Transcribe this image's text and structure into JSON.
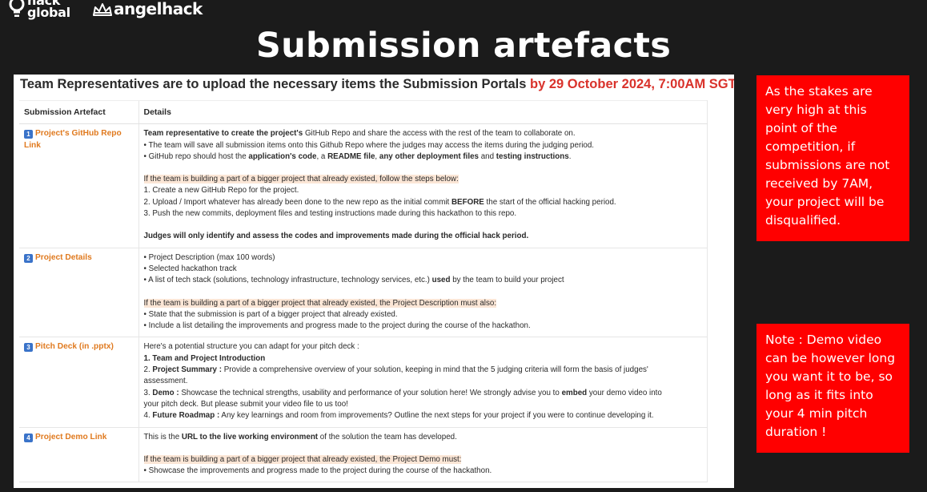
{
  "logos": {
    "hackglobal_line1": "hack",
    "hackglobal_line2": "global",
    "angelhack": "angelhack"
  },
  "slide_title": "Submission artefacts",
  "doc": {
    "heading": "Team Representatives are to upload the necessary items the Submission Portals",
    "deadline": "by 29 October 2024, 7:00AM SGT",
    "columns": [
      "Submission Artefact",
      "Details"
    ],
    "rows": [
      {
        "num": "1",
        "name_l1": "Project's GitHub Repo",
        "name_l2": "Link",
        "l1a": "Team representative to create the project's ",
        "l1b": "GitHub Repo",
        "l1c": " and share the access with the rest of the team to collaborate on.",
        "l2": "• The team will save all submission items onto this Github Repo where the judges may access the items during the judging period.",
        "l3a": "• GitHub repo should host the ",
        "l3b": "application's code",
        "l3c": ", a ",
        "l3d": "README file",
        "l3e": ", ",
        "l3f": "any other deployment files",
        "l3g": " and ",
        "l3h": "testing instructions",
        "l3i": ".",
        "hl": "If the team is building a part of a bigger project that already existed, follow the steps below:",
        "s1": "1. Create a new GitHub Repo for the project.",
        "s2a": "2. Upload / Import whatever has already been done to the new repo as the initial commit ",
        "s2b": "BEFORE",
        "s2c": " the start of the official hacking period.",
        "s3": "3. Push the new commits, deployment files and testing instructions made during this hackathon to this repo.",
        "judges": "Judges will only identify and assess the codes and improvements made during the official hack period."
      },
      {
        "num": "2",
        "name": "Project Details",
        "l1": "• Project Description (max 100 words)",
        "l2": "• Selected hackathon track",
        "l3a": "• A list of tech stack (solutions, technology infrastructure, technology services, etc.) ",
        "l3b": "used",
        "l3c": " by the team to build your project",
        "hl": "If the team is building a part of a bigger project that already existed, the Project Description must also:",
        "l4": "• State that the submission is part of a bigger project that already existed.",
        "l5": "• Include a list detailing the improvements and progress made to the project during the course of the hackathon."
      },
      {
        "num": "3",
        "name": "Pitch Deck (in .pptx)",
        "l1": "Here's a potential structure you can adapt for your pitch deck :",
        "l2": "1. Team and Project Introduction",
        "l3a": "2. ",
        "l3b": "Project Summary :",
        "l3c": " Provide a comprehensive overview of your solution, keeping in mind that the 5 judging criteria will form the basis of judges'",
        "l3d": "assessment.",
        "l4a": "3. ",
        "l4b": "Demo :",
        "l4c": " Showcase the technical strengths, usability and performance of your solution here! We strongly advise you to ",
        "l4d": "embed",
        "l4e": " your demo video into",
        "l4f": "your pitch deck. But please submit your video file to us too!",
        "l5a": "4. ",
        "l5b": "Future Roadmap :",
        "l5c": " Any key learnings and room from improvements? Outline the next steps for your project if you were to continue developing it."
      },
      {
        "num": "4",
        "name": "Project Demo Link",
        "l1a": "This is the ",
        "l1b": "URL to the live working environment",
        "l1c": " of the solution the team has developed.",
        "hl": "If the team is building a part of a bigger project that already existed, the Project Demo must:",
        "l2": "• Showcase the improvements and progress made to the project during the course of the hackathon."
      }
    ]
  },
  "notes": {
    "note1": "As the stakes are very high at this point of the competition, if submissions are not received by 7AM, your project will be disqualified.",
    "note2": "Note : Demo video can be however long you want it to be, so long as it fits into your 4 min pitch duration !"
  },
  "colors": {
    "background": "#1b1b1b",
    "note_red": "#ff0000",
    "deadline_red": "#d9322b",
    "artefact_orange": "#e07a1f",
    "highlight": "#fbe6d6",
    "badge_blue": "#3a73c9"
  },
  "icons": [
    "lightbulb-icon",
    "tiara-icon"
  ]
}
